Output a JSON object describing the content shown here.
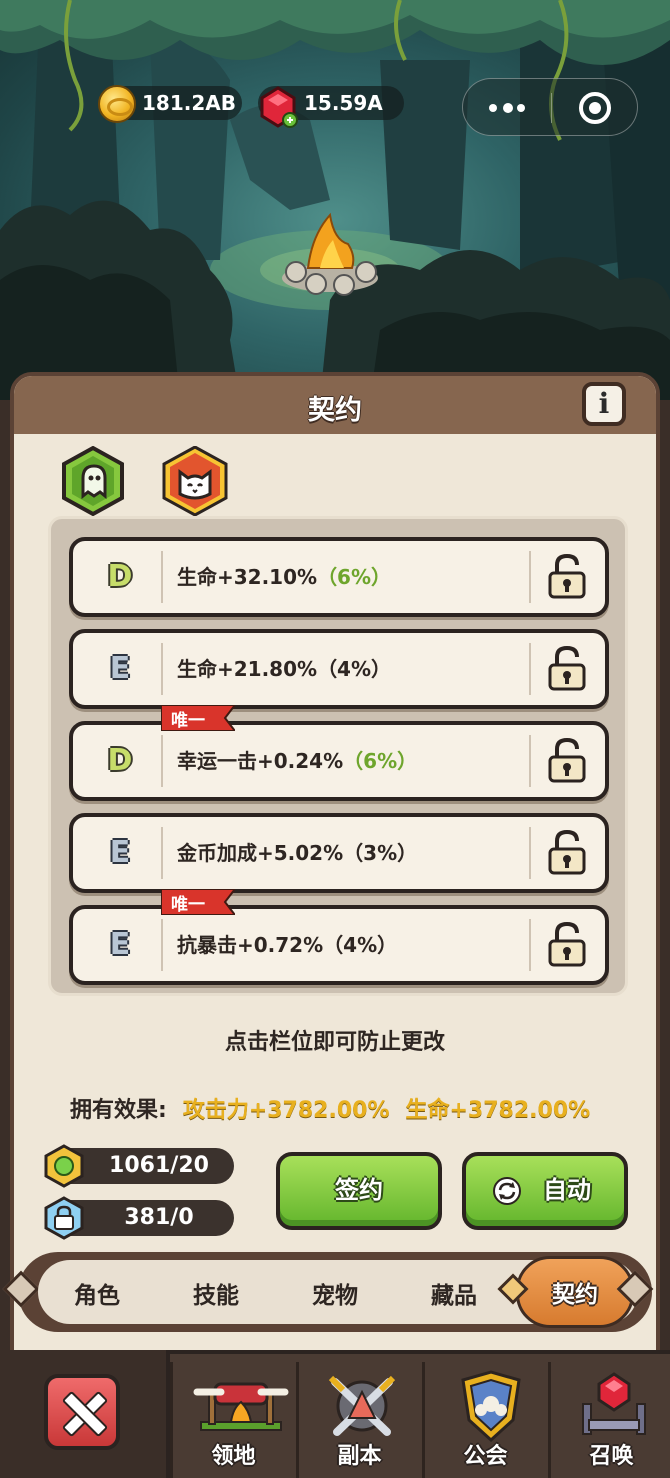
{
  "top_bar": {
    "gold": "181.2AB",
    "gems": "15.59A",
    "icons": [
      "gold-coin-icon",
      "red-gem-icon",
      "more-icon",
      "target-icon"
    ]
  },
  "panel": {
    "title": "契约",
    "info_label": "i",
    "type_tabs": [
      {
        "name": "green-ghost-tab",
        "selected": false
      },
      {
        "name": "orange-cat-tab",
        "selected": true
      }
    ],
    "slots": [
      {
        "grade": "D",
        "text": "生命+32.10%",
        "pct": "（6%）",
        "pct_green": true,
        "unique": false
      },
      {
        "grade": "E",
        "text": "生命+21.80%",
        "pct": "（4%）",
        "pct_green": false,
        "unique": false
      },
      {
        "grade": "D",
        "text": "幸运一击+0.24%",
        "pct": "（6%）",
        "pct_green": true,
        "unique": true
      },
      {
        "grade": "E",
        "text": "金币加成+5.02%",
        "pct": "（3%）",
        "pct_green": false,
        "unique": false
      },
      {
        "grade": "E",
        "text": "抗暴击+0.72%",
        "pct": "（4%）",
        "pct_green": false,
        "unique": true
      }
    ],
    "unique_label": "唯一",
    "hint": "点击栏位即可防止更改",
    "effects_label": "拥有效果:",
    "effect_1": "攻击力+3782.00%",
    "effect_2": "生命+3782.00%",
    "counter_1": "1061/20",
    "counter_2": "381/0",
    "sign_button": "签约",
    "auto_button": "自动"
  },
  "sub_nav": {
    "items": [
      "角色",
      "技能",
      "宠物",
      "藏品",
      "契约"
    ],
    "active_index": 4
  },
  "bottom_nav": {
    "items": [
      "领地",
      "副本",
      "公会",
      "召唤"
    ]
  },
  "colors": {
    "panel_bg": "#efe7d8",
    "header_brown": "#86664f",
    "button_green": "#63b52c",
    "active_orange": "#d77b2f",
    "accent_yellow": "#e8b01f"
  }
}
